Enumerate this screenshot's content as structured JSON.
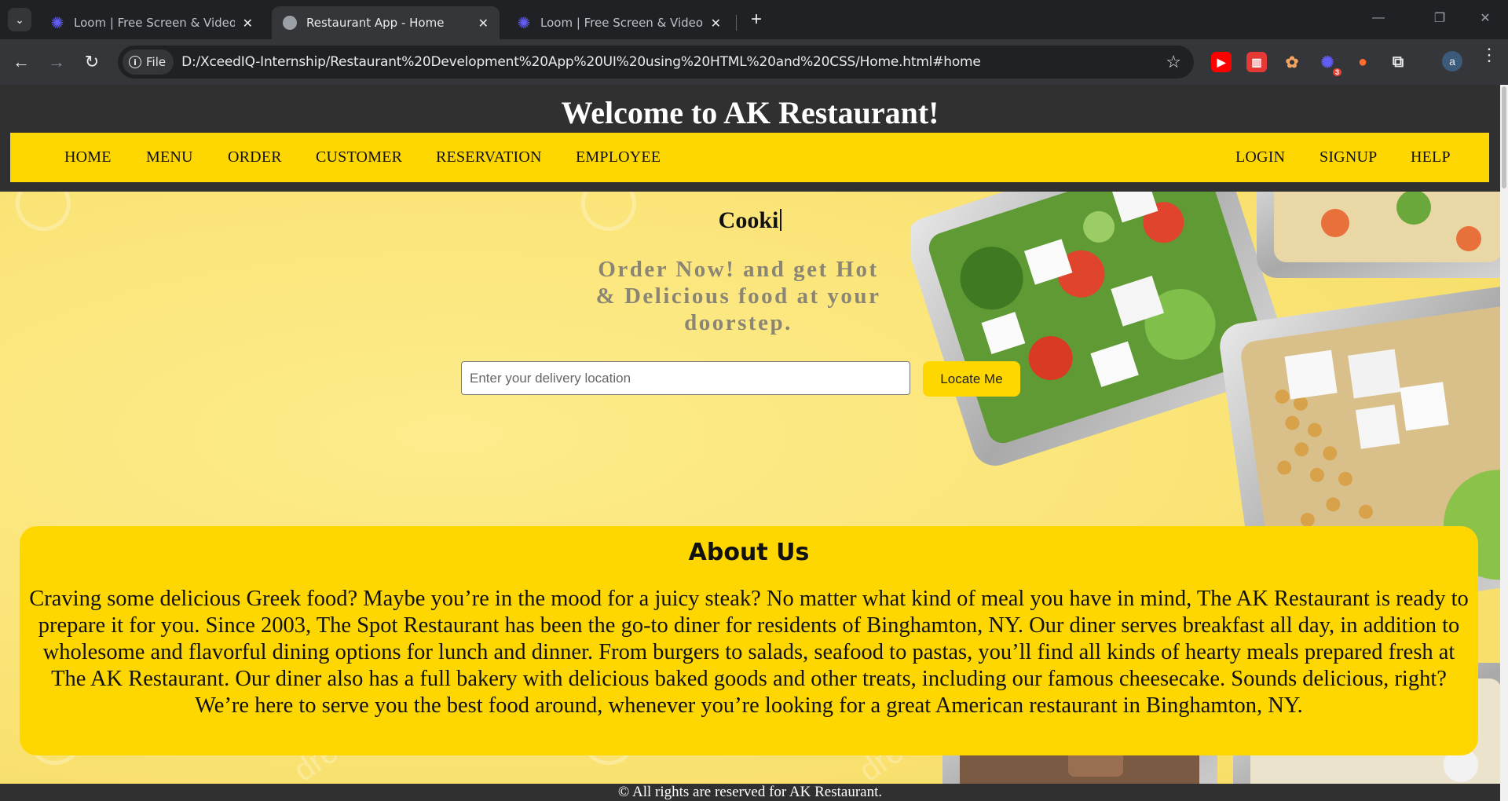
{
  "browser": {
    "tabs": [
      {
        "title": "Loom | Free Screen & Video Recording Software",
        "icon": "loom-icon"
      },
      {
        "title": "Restaurant App - Home",
        "icon": "globe-icon"
      },
      {
        "title": "Loom | Free Screen & Video Recording Software",
        "icon": "loom-icon"
      }
    ],
    "address": {
      "scheme_label": "File",
      "url": "D:/XceedIQ-Internship/Restaurant%20Development%20App%20UI%20using%20HTML%20and%20CSS/Home.html#home"
    },
    "extension_badge": "3",
    "profile_initial": "a"
  },
  "site": {
    "title": "Welcome to AK Restaurant!",
    "nav_left": [
      "HOME",
      "MENU",
      "ORDER",
      "CUSTOMER",
      "RESERVATION",
      "EMPLOYEE"
    ],
    "nav_right": [
      "LOGIN",
      "SIGNUP",
      "HELP"
    ]
  },
  "hero": {
    "typing_text": "Cooki",
    "tagline": "Order Now! and get Hot & Delicious food at your doorstep.",
    "location_placeholder": "Enter your delivery location",
    "locate_button": "Locate Me",
    "watermark": "dreamstime"
  },
  "about": {
    "title": "About Us",
    "text": "Craving some delicious Greek food? Maybe you’re in the mood for a juicy steak? No matter what kind of meal you have in mind, The AK Restaurant is ready to prepare it for you. Since 2003, The Spot Restaurant has been the go-to diner for residents of Binghamton, NY. Our diner serves breakfast all day, in addition to wholesome and flavorful dining options for lunch and dinner. From burgers to salads, seafood to pastas, you’ll find all kinds of hearty meals prepared fresh at The AK Restaurant. Our diner also has a full bakery with delicious baked goods and other treats, including our famous cheesecake. Sounds delicious, right? We’re here to serve you the best food around, whenever you’re looking for a great American restaurant in Binghamton, NY."
  },
  "footer": {
    "text": "© All rights are reserved for AK Restaurant."
  },
  "colors": {
    "header_bg": "#303030",
    "nav_bg": "#ffd700",
    "hero_bg": "#fbe57a",
    "about_bg": "#ffd700"
  }
}
